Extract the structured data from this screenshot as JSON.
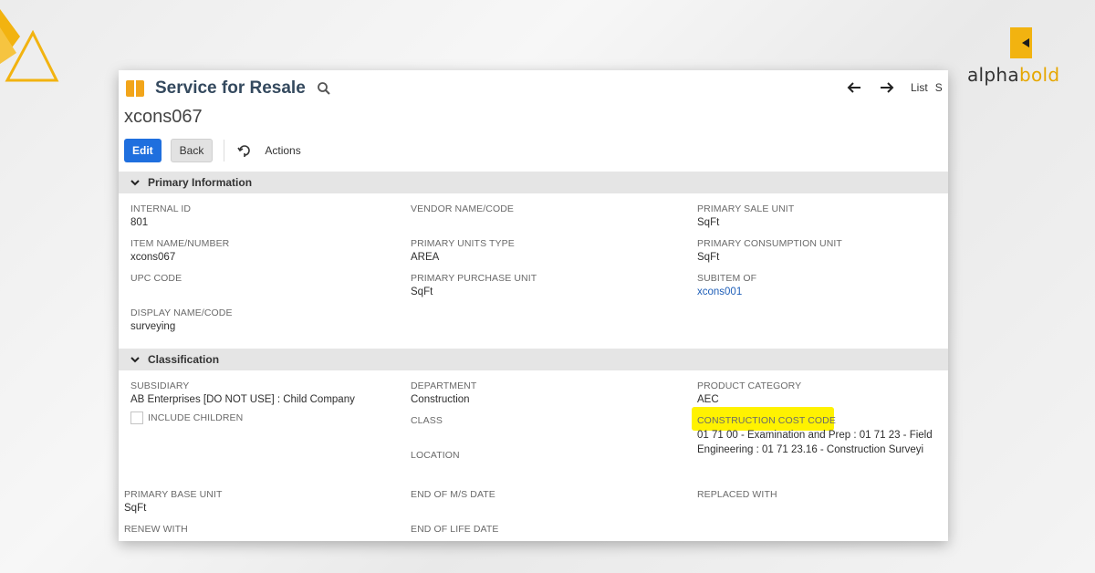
{
  "brand": {
    "part1": "alpha",
    "part2": "bold"
  },
  "header": {
    "title": "Service for Resale",
    "record_name": "xcons067",
    "nav_list": "List",
    "nav_truncated": "S"
  },
  "toolbar": {
    "edit": "Edit",
    "back": "Back",
    "actions": "Actions"
  },
  "primary": {
    "section_title": "Primary Information",
    "internal_id": {
      "label": "INTERNAL ID",
      "value": "801"
    },
    "item_name": {
      "label": "ITEM NAME/NUMBER",
      "value": "xcons067"
    },
    "upc_code": {
      "label": "UPC CODE",
      "value": ""
    },
    "display_name": {
      "label": "DISPLAY NAME/CODE",
      "value": "surveying"
    },
    "vendor_name": {
      "label": "VENDOR NAME/CODE",
      "value": ""
    },
    "units_type": {
      "label": "PRIMARY UNITS TYPE",
      "value": "AREA"
    },
    "purchase_unit": {
      "label": "PRIMARY PURCHASE UNIT",
      "value": "SqFt"
    },
    "sale_unit": {
      "label": "PRIMARY SALE UNIT",
      "value": "SqFt"
    },
    "consumption_unit": {
      "label": "PRIMARY CONSUMPTION UNIT",
      "value": "SqFt"
    },
    "subitem_of": {
      "label": "SUBITEM OF",
      "value": "xcons001"
    }
  },
  "classification": {
    "section_title": "Classification",
    "subsidiary": {
      "label": "SUBSIDIARY",
      "value": "AB Enterprises [DO NOT USE] : Child Company"
    },
    "include_children": "INCLUDE CHILDREN",
    "department": {
      "label": "DEPARTMENT",
      "value": "Construction"
    },
    "class": {
      "label": "CLASS",
      "value": ""
    },
    "location": {
      "label": "LOCATION",
      "value": ""
    },
    "product_category": {
      "label": "PRODUCT CATEGORY",
      "value": "AEC"
    },
    "construction_cost_code": {
      "label": "CONSTRUCTION COST CODE",
      "line1": "01 71 00 - Examination and Prep : 01 71 23 - Field",
      "line2": "Engineering : 01 71 23.16 - Construction Surveyi"
    }
  },
  "extra": {
    "primary_base_unit": {
      "label": "PRIMARY BASE UNIT",
      "value": "SqFt"
    },
    "renew_with": {
      "label": "RENEW WITH",
      "value": ""
    },
    "end_of_ms_date": {
      "label": "END OF M/S DATE",
      "value": ""
    },
    "end_of_life_date": {
      "label": "END OF LIFE DATE",
      "value": ""
    },
    "replaced_with": {
      "label": "REPLACED WITH",
      "value": ""
    }
  },
  "colors": {
    "accent_blue": "#1f6fde",
    "record_icon": "#f2a51a",
    "brand_yellow": "#f2b310",
    "highlight": "#fff200",
    "link": "#1f5fb8"
  },
  "icons": [
    "triangle-logo-icon",
    "alphabold-mark-icon",
    "record-type-icon",
    "search-icon",
    "arrow-left-icon",
    "arrow-right-icon",
    "actions-icon",
    "chevron-down-icon"
  ]
}
